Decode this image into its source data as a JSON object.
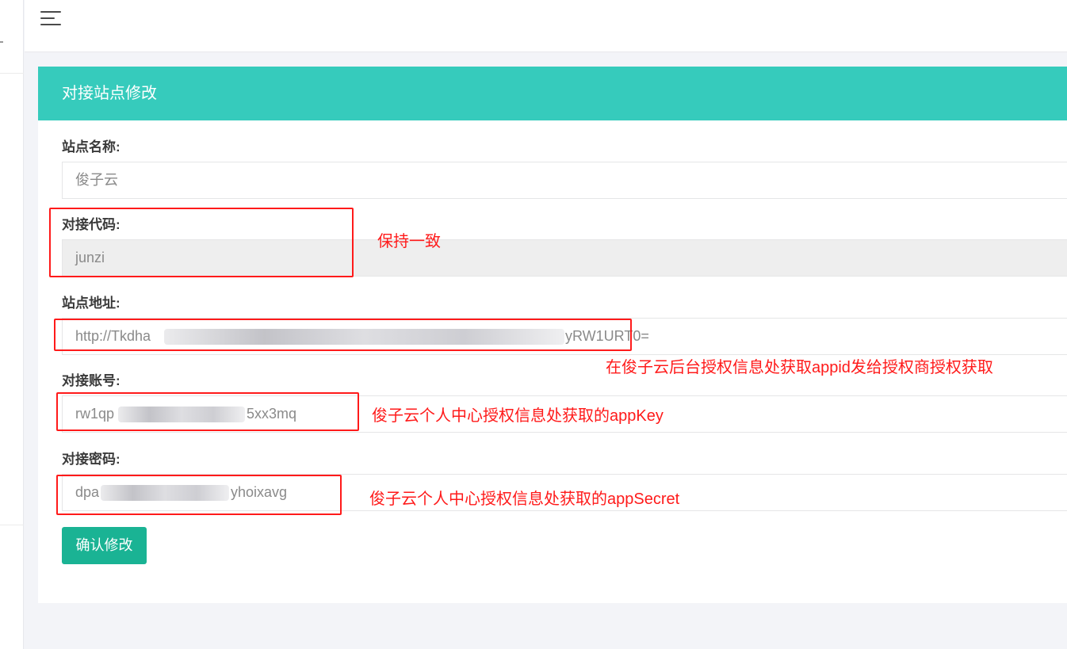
{
  "panel": {
    "title": "对接站点修改"
  },
  "form": {
    "site_name": {
      "label": "站点名称:",
      "value": "俊子云"
    },
    "code": {
      "label": "对接代码:",
      "value": "junzi"
    },
    "url": {
      "label": "站点地址:",
      "value_start": "http://Tkdha",
      "value_end": "yRW1URT0="
    },
    "account": {
      "label": "对接账号:",
      "value_start": "rw1qp",
      "value_end": "5xx3mq"
    },
    "password": {
      "label": "对接密码:",
      "value_start": "dpa",
      "value_end": "yhoixavg"
    },
    "submit_label": "确认修改"
  },
  "annotations": {
    "code_note": "保持一致",
    "url_note": "在俊子云后台授权信息处获取appid发给授权商授权获取",
    "account_note": "俊子云个人中心授权信息处获取的appKey",
    "password_note": "俊子云个人中心授权信息处获取的appSecret"
  },
  "colors": {
    "header_teal": "#36cbbc",
    "button_green": "#1ab394",
    "annotation_red": "#ff1a1a"
  },
  "icons": {
    "menu": "hamburger-menu-icon"
  }
}
